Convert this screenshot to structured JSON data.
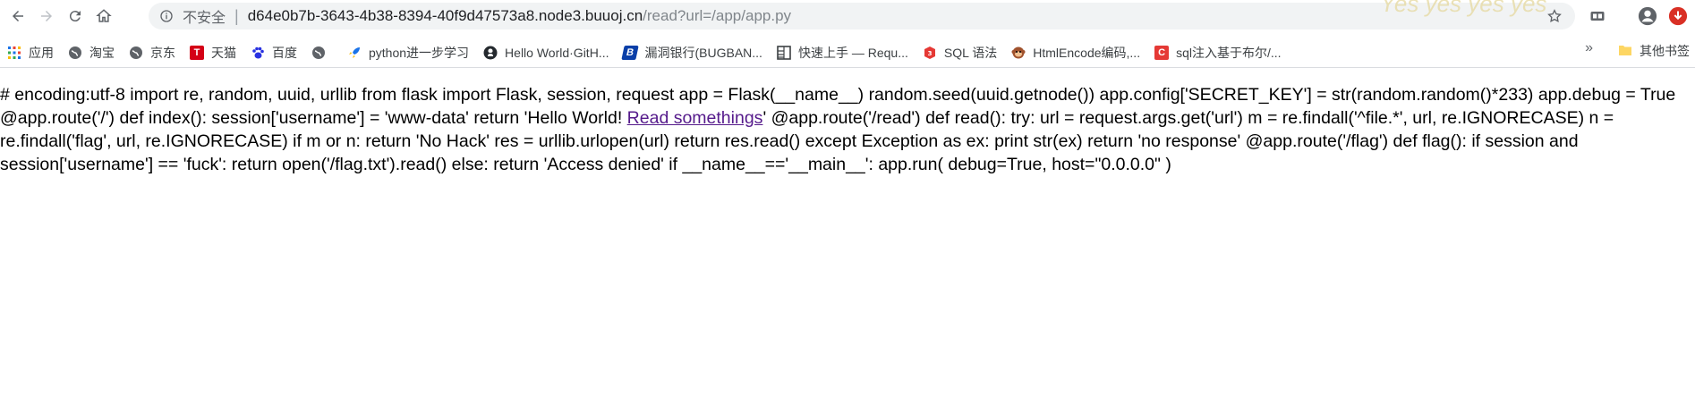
{
  "browser": {
    "insecure_label": "不安全",
    "separator": "|",
    "url_host": "d64e0b7b-3643-4b38-8394-40f9d47573a8.node3.buuoj.cn",
    "url_path": "/read?url=/app/app.py",
    "watermark": "Yes yes yes yes"
  },
  "bookmarks": {
    "items": [
      {
        "label": "应用",
        "icon": "apps-grid-icon"
      },
      {
        "label": "淘宝",
        "icon": "globe-icon"
      },
      {
        "label": "京东",
        "icon": "globe-icon"
      },
      {
        "label": "天猫",
        "icon": "tmall-icon"
      },
      {
        "label": "百度",
        "icon": "baidu-paw-icon"
      },
      {
        "label": "",
        "icon": "globe-icon"
      },
      {
        "label": "python进一步学习",
        "icon": "rocket-icon"
      },
      {
        "label": "Hello World·GitH...",
        "icon": "github-icon"
      },
      {
        "label": "漏洞银行(BUGBAN...",
        "icon": "bugbank-icon"
      },
      {
        "label": "快速上手 — Requ...",
        "icon": "doc-grid-icon"
      },
      {
        "label": "SQL 语法",
        "icon": "w3-icon"
      },
      {
        "label": "HtmlEncode编码,...",
        "icon": "monkey-icon"
      },
      {
        "label": "sql注入基于布尔/...",
        "icon": "csdn-icon"
      }
    ],
    "more": "»",
    "other": "其他书签"
  },
  "page": {
    "text_before_link": "# encoding:utf-8 import re, random, uuid, urllib from flask import Flask, session, request app = Flask(__name__) random.seed(uuid.getnode()) app.config['SECRET_KEY'] = str(random.random()*233) app.debug = True @app.route('/') def index(): session['username'] = 'www-data' return 'Hello World! ",
    "link_text": "Read somethings",
    "text_after_link": "' @app.route('/read') def read(): try: url = request.args.get('url') m = re.findall('^file.*', url, re.IGNORECASE) n = re.findall('flag', url, re.IGNORECASE) if m or n: return 'No Hack' res = urllib.urlopen(url) return res.read() except Exception as ex: print str(ex) return 'no response' @app.route('/flag') def flag(): if session and session['username'] == 'fuck': return open('/flag.txt').read() else: return 'Access denied' if __name__=='__main__': app.run( debug=True, host=\"0.0.0.0\" )"
  },
  "colors": {
    "link": "#551a8b",
    "omnibox_bg": "#f1f3f4",
    "profile_badge": "#d93025"
  }
}
